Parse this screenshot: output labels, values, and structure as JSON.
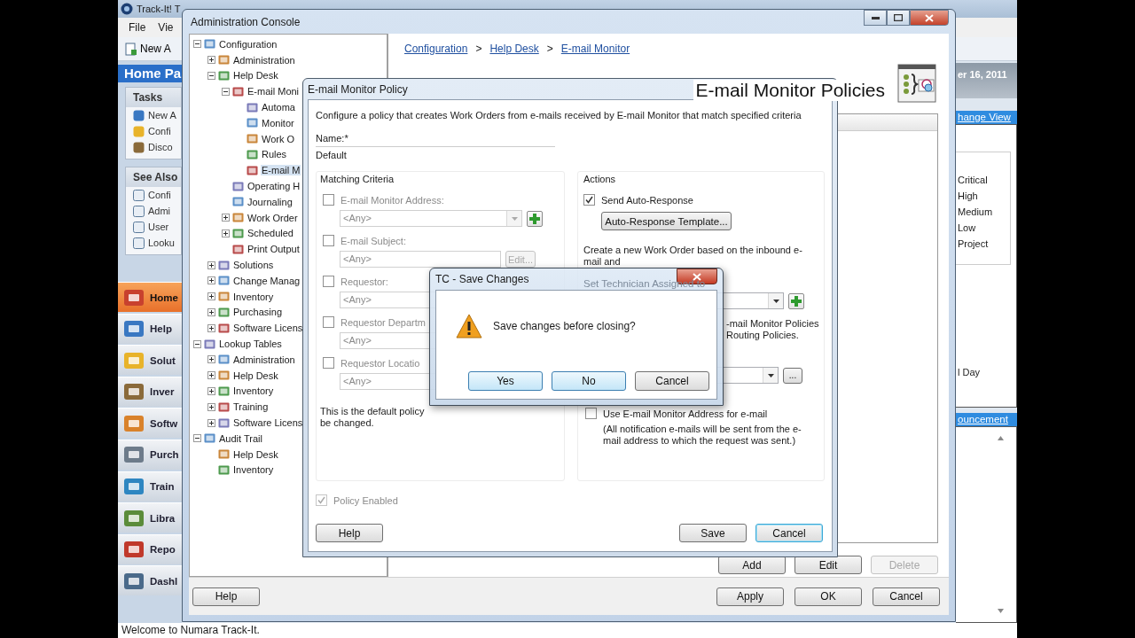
{
  "main_window": {
    "title": "Track-It! T",
    "menu": [
      "File",
      "Vie"
    ],
    "toolbar_button": "New A",
    "home_header": "Home Pa",
    "tasks": {
      "title": "Tasks",
      "items": [
        "New A",
        "Confi",
        "Disco"
      ]
    },
    "see_also": {
      "title": "See Also",
      "items": [
        "Confi",
        "Admi",
        "User",
        "Looku"
      ]
    },
    "nav": [
      {
        "label": "Home",
        "selected": true
      },
      {
        "label": "Help",
        "selected": false
      },
      {
        "label": "Solut",
        "selected": false
      },
      {
        "label": "Inver",
        "selected": false
      },
      {
        "label": "Softw",
        "selected": false
      },
      {
        "label": "Purch",
        "selected": false
      },
      {
        "label": "Train",
        "selected": false
      },
      {
        "label": "Libra",
        "selected": false
      },
      {
        "label": "Repo",
        "selected": false
      },
      {
        "label": "Dashl",
        "selected": false
      }
    ],
    "date": "er 16, 2011",
    "change_view": "hange View",
    "priorities": [
      "Critical",
      "High",
      "Medium",
      "Low",
      "Project"
    ],
    "day_label": "l Day",
    "announcement": "ouncement",
    "status_bar": "Welcome to Numara Track-It."
  },
  "console": {
    "title": "Administration Console",
    "tree": [
      {
        "label": "Configuration",
        "expanded": true,
        "selected": false,
        "children": [
          {
            "label": "Administration",
            "expanded": false,
            "selected": false
          },
          {
            "label": "Help Desk",
            "expanded": true,
            "selected": false,
            "children": [
              {
                "label": "E-mail Moni",
                "expanded": true,
                "selected": false,
                "children": [
                  {
                    "label": "Automa",
                    "selected": false
                  },
                  {
                    "label": "Monitor",
                    "selected": false
                  },
                  {
                    "label": "Work O",
                    "selected": false
                  },
                  {
                    "label": "Rules",
                    "selected": false
                  },
                  {
                    "label": "E-mail M",
                    "selected": true
                  }
                ]
              },
              {
                "label": "Operating H",
                "selected": false
              },
              {
                "label": "Journaling",
                "selected": false
              },
              {
                "label": "Work Order",
                "expanded": false,
                "selected": false
              },
              {
                "label": "Scheduled",
                "expanded": false,
                "selected": false
              },
              {
                "label": "Print Output",
                "selected": false
              }
            ]
          },
          {
            "label": "Solutions",
            "expanded": false,
            "selected": false
          },
          {
            "label": "Change Manag",
            "expanded": false,
            "selected": false
          },
          {
            "label": "Inventory",
            "expanded": false,
            "selected": false
          },
          {
            "label": "Purchasing",
            "expanded": false,
            "selected": false
          },
          {
            "label": "Software Licens",
            "expanded": false,
            "selected": false
          }
        ]
      },
      {
        "label": "Lookup Tables",
        "expanded": true,
        "selected": false,
        "children": [
          {
            "label": "Administration",
            "expanded": false,
            "selected": false
          },
          {
            "label": "Help Desk",
            "expanded": false,
            "selected": false
          },
          {
            "label": "Inventory",
            "expanded": false,
            "selected": false
          },
          {
            "label": "Training",
            "expanded": false,
            "selected": false
          },
          {
            "label": "Software Licens",
            "expanded": false,
            "selected": false
          }
        ]
      },
      {
        "label": "Audit Trail",
        "expanded": true,
        "selected": false,
        "children": [
          {
            "label": "Help Desk",
            "selected": false
          },
          {
            "label": "Inventory",
            "selected": false
          }
        ]
      }
    ],
    "breadcrumb": [
      "Configuration",
      "Help Desk",
      "E-mail Monitor"
    ],
    "breadcrumb_separators": [
      ">",
      ">"
    ],
    "heading": "E-mail Monitor Policies",
    "list_buttons": [
      {
        "label": "Add",
        "disabled": false
      },
      {
        "label": "Edit",
        "disabled": false
      },
      {
        "label": "Delete",
        "disabled": true
      }
    ],
    "help_button": "Help",
    "buttons": [
      "Apply",
      "OK",
      "Cancel"
    ]
  },
  "policy_dialog": {
    "title": "E-mail Monitor Policy",
    "description": "Configure a policy that creates Work Orders from e-mails received by E-mail Monitor that match specified criteria",
    "name_label": "Name:*",
    "name_value": "Default",
    "criteria": {
      "title": "Matching Criteria",
      "items": [
        {
          "kind": "combo",
          "label": "E-mail Monitor Address:",
          "value": "<Any>",
          "checked": false
        },
        {
          "kind": "edit",
          "label": "E-mail Subject:",
          "value": "<Any>",
          "checked": false,
          "button": {
            "label": "Edit...",
            "disabled": true
          }
        },
        {
          "kind": "text",
          "label": "Requestor:",
          "value": "<Any>",
          "checked": false
        },
        {
          "kind": "text",
          "label": "Requestor Departm",
          "value": "<Any>",
          "checked": false
        },
        {
          "kind": "text",
          "label": "Requestor Locatio",
          "value": "<Any>",
          "checked": false
        }
      ],
      "note_lines": [
        "This is the default policy",
        "be changed."
      ]
    },
    "actions": {
      "title": "Actions",
      "auto_response": {
        "label": "Send Auto-Response",
        "checked": true
      },
      "template_button": "Auto-Response Template...",
      "create_text": "Create a new Work Order based on the inbound e-mail and",
      "technician_label": "Set Technician Assigned to",
      "technician_note": [
        "-mail Monitor Policies",
        "Routing Policies."
      ],
      "browse_button": "...",
      "use_address": {
        "label": "Use E-mail Monitor Address for e-mail",
        "checked": false
      },
      "notification_note": "(All notification e-mails will be sent from the e-mail address to which the request was sent.)"
    },
    "policy_enabled": {
      "label": "Policy Enabled",
      "checked": true,
      "disabled": true
    },
    "buttons": [
      {
        "label": "Help",
        "focused": false
      },
      {
        "label": "Save",
        "focused": false
      },
      {
        "label": "Cancel",
        "focused": true
      }
    ]
  },
  "save_dialog": {
    "title": "TC - Save Changes",
    "message": "Save changes before closing?",
    "buttons": [
      {
        "label": "Yes",
        "highlighted": true
      },
      {
        "label": "No",
        "highlighted": true
      },
      {
        "label": "Cancel",
        "highlighted": false
      }
    ]
  }
}
